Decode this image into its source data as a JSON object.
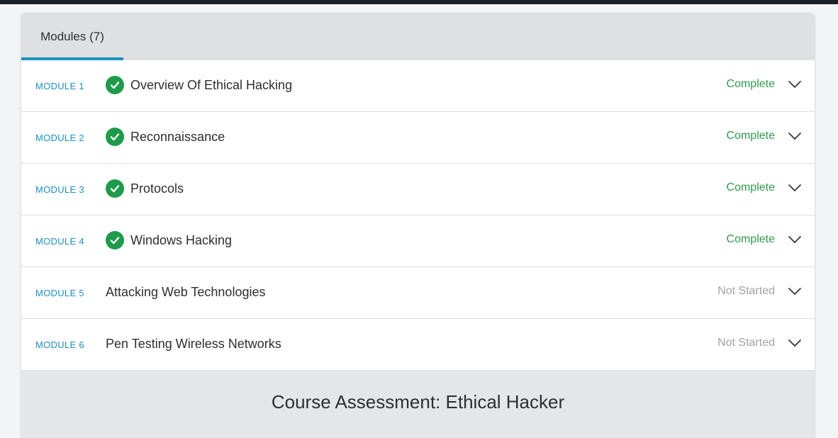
{
  "tabs": [
    {
      "label": "Modules (7)",
      "active": true
    }
  ],
  "accent_color": "#1d8fc1",
  "complete_color": "#2e9a4c",
  "modules": [
    {
      "label": "MODULE 1",
      "title": "Overview Of Ethical Hacking",
      "status": "Complete",
      "done": true
    },
    {
      "label": "MODULE 2",
      "title": "Reconnaissance",
      "status": "Complete",
      "done": true
    },
    {
      "label": "MODULE 3",
      "title": "Protocols",
      "status": "Complete",
      "done": true
    },
    {
      "label": "MODULE 4",
      "title": "Windows Hacking",
      "status": "Complete",
      "done": true
    },
    {
      "label": "MODULE 5",
      "title": "Attacking Web Technologies",
      "status": "Not Started",
      "done": false
    },
    {
      "label": "MODULE 6",
      "title": "Pen Testing Wireless Networks",
      "status": "Not Started",
      "done": false
    }
  ],
  "assessment": {
    "title": "Course Assessment: Ethical Hacker"
  },
  "icons": {
    "check": "check-circle-icon",
    "expand": "chevron-down-icon"
  }
}
